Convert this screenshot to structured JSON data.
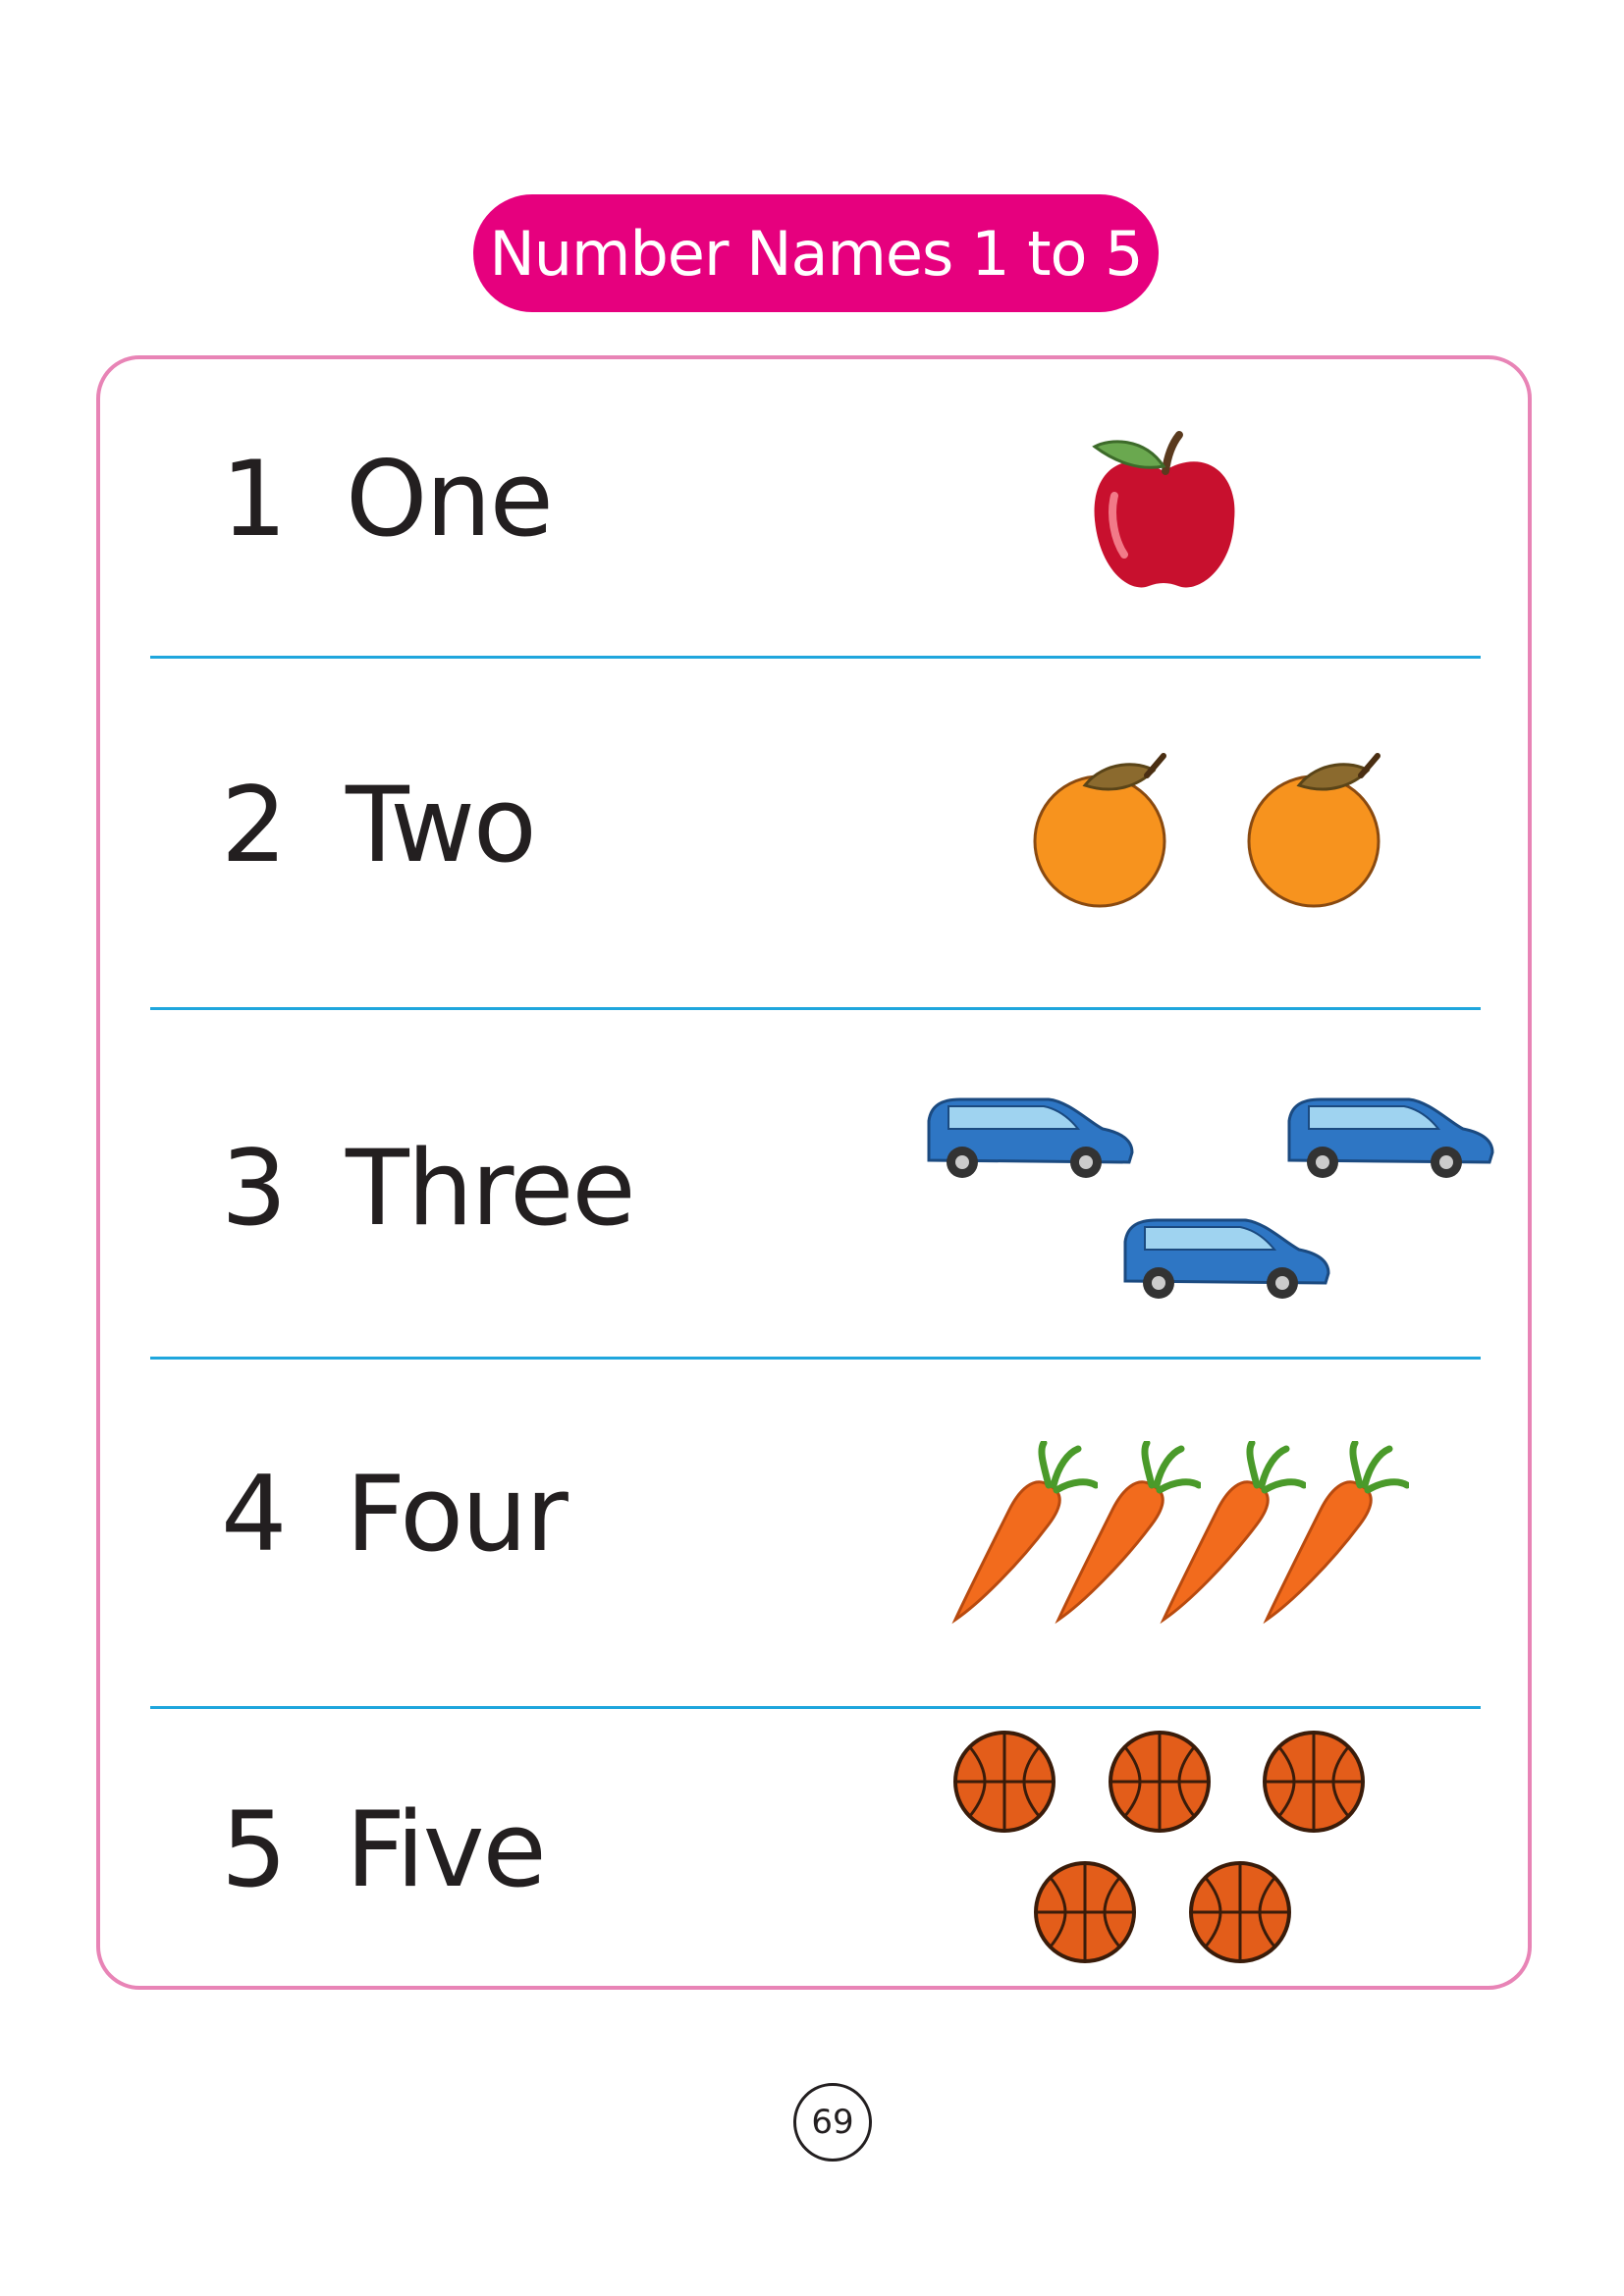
{
  "title": "Number Names 1 to 5",
  "rows": [
    {
      "numeral": "1",
      "word": "One",
      "picture": "apple",
      "count": 1
    },
    {
      "numeral": "2",
      "word": "Two",
      "picture": "orange",
      "count": 2
    },
    {
      "numeral": "3",
      "word": "Three",
      "picture": "car",
      "count": 3
    },
    {
      "numeral": "4",
      "word": "Four",
      "picture": "carrot",
      "count": 4
    },
    {
      "numeral": "5",
      "word": "Five",
      "picture": "basketball",
      "count": 5
    }
  ],
  "page_number": "69",
  "colors": {
    "title_bg": "#e6007e",
    "card_border": "#e884b6",
    "divider": "#1fa6dd"
  }
}
